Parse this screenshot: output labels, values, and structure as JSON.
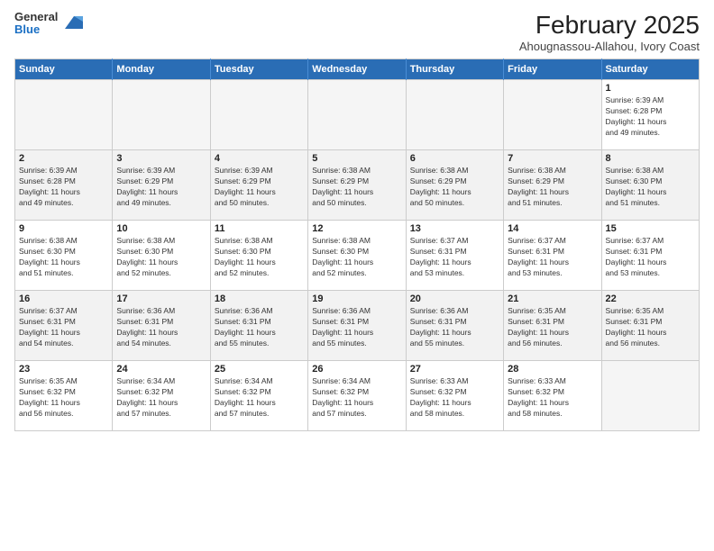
{
  "header": {
    "logo": {
      "line1": "General",
      "line2": "Blue"
    },
    "title": "February 2025",
    "location": "Ahougnassou-Allahou, Ivory Coast"
  },
  "weekdays": [
    "Sunday",
    "Monday",
    "Tuesday",
    "Wednesday",
    "Thursday",
    "Friday",
    "Saturday"
  ],
  "weeks": [
    [
      {
        "day": "",
        "info": ""
      },
      {
        "day": "",
        "info": ""
      },
      {
        "day": "",
        "info": ""
      },
      {
        "day": "",
        "info": ""
      },
      {
        "day": "",
        "info": ""
      },
      {
        "day": "",
        "info": ""
      },
      {
        "day": "1",
        "info": "Sunrise: 6:39 AM\nSunset: 6:28 PM\nDaylight: 11 hours\nand 49 minutes."
      }
    ],
    [
      {
        "day": "2",
        "info": "Sunrise: 6:39 AM\nSunset: 6:28 PM\nDaylight: 11 hours\nand 49 minutes."
      },
      {
        "day": "3",
        "info": "Sunrise: 6:39 AM\nSunset: 6:29 PM\nDaylight: 11 hours\nand 49 minutes."
      },
      {
        "day": "4",
        "info": "Sunrise: 6:39 AM\nSunset: 6:29 PM\nDaylight: 11 hours\nand 50 minutes."
      },
      {
        "day": "5",
        "info": "Sunrise: 6:38 AM\nSunset: 6:29 PM\nDaylight: 11 hours\nand 50 minutes."
      },
      {
        "day": "6",
        "info": "Sunrise: 6:38 AM\nSunset: 6:29 PM\nDaylight: 11 hours\nand 50 minutes."
      },
      {
        "day": "7",
        "info": "Sunrise: 6:38 AM\nSunset: 6:29 PM\nDaylight: 11 hours\nand 51 minutes."
      },
      {
        "day": "8",
        "info": "Sunrise: 6:38 AM\nSunset: 6:30 PM\nDaylight: 11 hours\nand 51 minutes."
      }
    ],
    [
      {
        "day": "9",
        "info": "Sunrise: 6:38 AM\nSunset: 6:30 PM\nDaylight: 11 hours\nand 51 minutes."
      },
      {
        "day": "10",
        "info": "Sunrise: 6:38 AM\nSunset: 6:30 PM\nDaylight: 11 hours\nand 52 minutes."
      },
      {
        "day": "11",
        "info": "Sunrise: 6:38 AM\nSunset: 6:30 PM\nDaylight: 11 hours\nand 52 minutes."
      },
      {
        "day": "12",
        "info": "Sunrise: 6:38 AM\nSunset: 6:30 PM\nDaylight: 11 hours\nand 52 minutes."
      },
      {
        "day": "13",
        "info": "Sunrise: 6:37 AM\nSunset: 6:31 PM\nDaylight: 11 hours\nand 53 minutes."
      },
      {
        "day": "14",
        "info": "Sunrise: 6:37 AM\nSunset: 6:31 PM\nDaylight: 11 hours\nand 53 minutes."
      },
      {
        "day": "15",
        "info": "Sunrise: 6:37 AM\nSunset: 6:31 PM\nDaylight: 11 hours\nand 53 minutes."
      }
    ],
    [
      {
        "day": "16",
        "info": "Sunrise: 6:37 AM\nSunset: 6:31 PM\nDaylight: 11 hours\nand 54 minutes."
      },
      {
        "day": "17",
        "info": "Sunrise: 6:36 AM\nSunset: 6:31 PM\nDaylight: 11 hours\nand 54 minutes."
      },
      {
        "day": "18",
        "info": "Sunrise: 6:36 AM\nSunset: 6:31 PM\nDaylight: 11 hours\nand 55 minutes."
      },
      {
        "day": "19",
        "info": "Sunrise: 6:36 AM\nSunset: 6:31 PM\nDaylight: 11 hours\nand 55 minutes."
      },
      {
        "day": "20",
        "info": "Sunrise: 6:36 AM\nSunset: 6:31 PM\nDaylight: 11 hours\nand 55 minutes."
      },
      {
        "day": "21",
        "info": "Sunrise: 6:35 AM\nSunset: 6:31 PM\nDaylight: 11 hours\nand 56 minutes."
      },
      {
        "day": "22",
        "info": "Sunrise: 6:35 AM\nSunset: 6:31 PM\nDaylight: 11 hours\nand 56 minutes."
      }
    ],
    [
      {
        "day": "23",
        "info": "Sunrise: 6:35 AM\nSunset: 6:32 PM\nDaylight: 11 hours\nand 56 minutes."
      },
      {
        "day": "24",
        "info": "Sunrise: 6:34 AM\nSunset: 6:32 PM\nDaylight: 11 hours\nand 57 minutes."
      },
      {
        "day": "25",
        "info": "Sunrise: 6:34 AM\nSunset: 6:32 PM\nDaylight: 11 hours\nand 57 minutes."
      },
      {
        "day": "26",
        "info": "Sunrise: 6:34 AM\nSunset: 6:32 PM\nDaylight: 11 hours\nand 57 minutes."
      },
      {
        "day": "27",
        "info": "Sunrise: 6:33 AM\nSunset: 6:32 PM\nDaylight: 11 hours\nand 58 minutes."
      },
      {
        "day": "28",
        "info": "Sunrise: 6:33 AM\nSunset: 6:32 PM\nDaylight: 11 hours\nand 58 minutes."
      },
      {
        "day": "",
        "info": ""
      }
    ]
  ]
}
